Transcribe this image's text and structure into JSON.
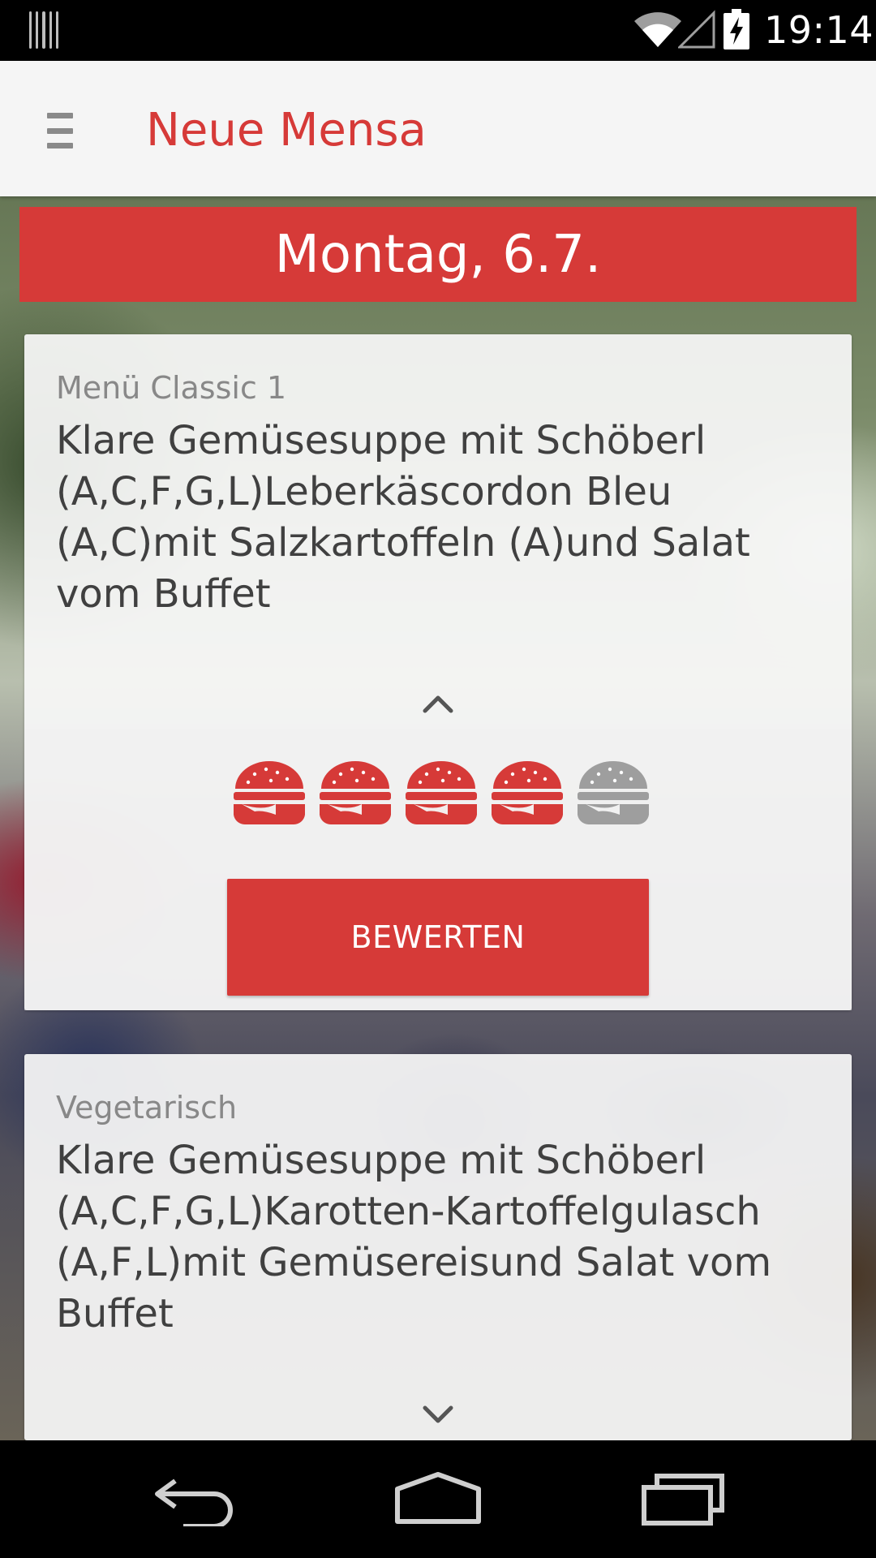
{
  "status_bar": {
    "time": "19:14",
    "icons": [
      "notification-icon",
      "wifi-icon",
      "signal-icon",
      "battery-charging-icon"
    ]
  },
  "app_bar": {
    "title": "Neue Mensa",
    "menu_icon": "menu-icon",
    "accent_color": "#d63a38"
  },
  "day": {
    "label": "Montag, 6.7."
  },
  "menus": [
    {
      "category": "Menü Classic 1",
      "description_lines": [
        "Klare Gemüsesuppe mit Schöberl",
        "(A,C,F,G,L)Leberkäscordon Bleu",
        "(A,C)mit Salzkartoffeln (A)und Salat",
        "vom Buffet"
      ],
      "expanded": true,
      "toggle_icon": "chevron-up-icon",
      "rating": {
        "value": 4,
        "max": 5,
        "icon": "burger-icon"
      },
      "rate_button_label": "BEWERTEN"
    },
    {
      "category": "Vegetarisch",
      "description_lines": [
        "Klare Gemüsesuppe mit Schöberl",
        "(A,C,F,G,L)Karotten-Kartoffelgulasch",
        "(A,F,L)mit Gemüsereisund Salat vom",
        "Buffet"
      ],
      "expanded": false,
      "toggle_icon": "chevron-down-icon"
    }
  ],
  "nav_bar": {
    "icons": [
      "back-icon",
      "home-icon",
      "recent-apps-icon"
    ]
  }
}
